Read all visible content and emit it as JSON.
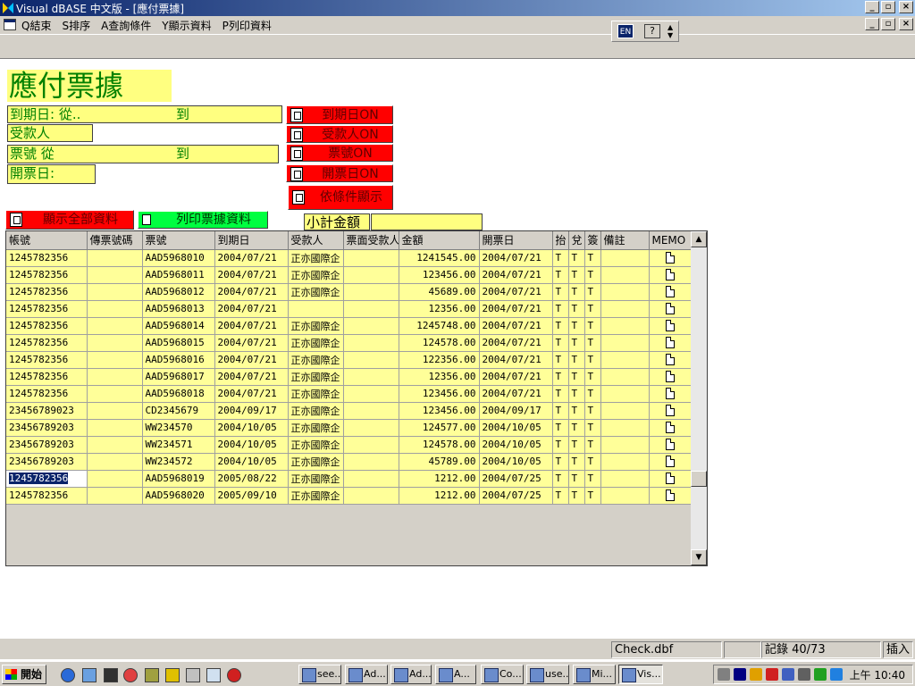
{
  "window": {
    "title": "Visual dBASE 中文版 - [應付票據]"
  },
  "menu": {
    "items": [
      "Q結束",
      "S排序",
      "A查詢條件",
      "Y顯示資料",
      "P列印資料"
    ]
  },
  "ime": {
    "lang": "EN",
    "help": "?"
  },
  "form": {
    "title": "應付票據",
    "due_from_label": "到期日: 從..",
    "due_to_label": "到",
    "payee_label": "受款人",
    "ticket_from_label": "票號 從",
    "ticket_to_label": "到",
    "issue_label": "開票日:",
    "btn_due_on": "到期日ON",
    "btn_payee_on": "受款人ON",
    "btn_ticket_on": "票號ON",
    "btn_issue_on": "開票日ON",
    "btn_filter": "依條件顯示",
    "btn_show_all": "顯示全部資料",
    "btn_print": "列印票據資料",
    "subtotal_label": "小計金額",
    "subtotal_value": ""
  },
  "grid": {
    "columns": [
      "帳號",
      "傳票號碼",
      "票號",
      "到期日",
      "受款人",
      "票面受款人",
      "金額",
      "開票日",
      "抬",
      "兌",
      "簽",
      "備註",
      "MEMO"
    ],
    "rows": [
      [
        "1245782356",
        "",
        "AAD5968010",
        "2004/07/21",
        "正亦國際企",
        "",
        "1241545.00",
        "2004/07/21",
        "T",
        "T",
        "T",
        "",
        ""
      ],
      [
        "1245782356",
        "",
        "AAD5968011",
        "2004/07/21",
        "正亦國際企",
        "",
        "123456.00",
        "2004/07/21",
        "T",
        "T",
        "T",
        "",
        ""
      ],
      [
        "1245782356",
        "",
        "AAD5968012",
        "2004/07/21",
        "正亦國際企",
        "",
        "45689.00",
        "2004/07/21",
        "T",
        "T",
        "T",
        "",
        ""
      ],
      [
        "1245782356",
        "",
        "AAD5968013",
        "2004/07/21",
        "",
        "",
        "12356.00",
        "2004/07/21",
        "T",
        "T",
        "T",
        "",
        ""
      ],
      [
        "1245782356",
        "",
        "AAD5968014",
        "2004/07/21",
        "正亦國際企",
        "",
        "1245748.00",
        "2004/07/21",
        "T",
        "T",
        "T",
        "",
        ""
      ],
      [
        "1245782356",
        "",
        "AAD5968015",
        "2004/07/21",
        "正亦國際企",
        "",
        "124578.00",
        "2004/07/21",
        "T",
        "T",
        "T",
        "",
        ""
      ],
      [
        "1245782356",
        "",
        "AAD5968016",
        "2004/07/21",
        "正亦國際企",
        "",
        "122356.00",
        "2004/07/21",
        "T",
        "T",
        "T",
        "",
        ""
      ],
      [
        "1245782356",
        "",
        "AAD5968017",
        "2004/07/21",
        "正亦國際企",
        "",
        "12356.00",
        "2004/07/21",
        "T",
        "T",
        "T",
        "",
        ""
      ],
      [
        "1245782356",
        "",
        "AAD5968018",
        "2004/07/21",
        "正亦國際企",
        "",
        "123456.00",
        "2004/07/21",
        "T",
        "T",
        "T",
        "",
        ""
      ],
      [
        "23456789023",
        "",
        "CD2345679",
        "2004/09/17",
        "正亦國際企",
        "",
        "123456.00",
        "2004/09/17",
        "T",
        "T",
        "T",
        "",
        ""
      ],
      [
        "23456789203",
        "",
        "WW234570",
        "2004/10/05",
        "正亦國際企",
        "",
        "124577.00",
        "2004/10/05",
        "T",
        "T",
        "T",
        "",
        ""
      ],
      [
        "23456789203",
        "",
        "WW234571",
        "2004/10/05",
        "正亦國際企",
        "",
        "124578.00",
        "2004/10/05",
        "T",
        "T",
        "T",
        "",
        ""
      ],
      [
        "23456789203",
        "",
        "WW234572",
        "2004/10/05",
        "正亦國際企",
        "",
        "45789.00",
        "2004/10/05",
        "T",
        "T",
        "T",
        "",
        ""
      ],
      [
        "1245782356",
        "",
        "AAD5968019",
        "2005/08/22",
        "正亦國際企",
        "",
        "1212.00",
        "2004/07/25",
        "T",
        "T",
        "T",
        "",
        ""
      ],
      [
        "1245782356",
        "",
        "AAD5968020",
        "2005/09/10",
        "正亦國際企",
        "",
        "1212.00",
        "2004/07/25",
        "T",
        "T",
        "T",
        "",
        ""
      ]
    ],
    "selected_row": 13
  },
  "status": {
    "file": "Check.dbf",
    "blank": "",
    "record": "記錄 40/73",
    "mode": "插入"
  },
  "taskbar": {
    "start": "開始",
    "tasks": [
      "see...",
      "Ad...",
      "Ad...",
      "A...",
      "Co...",
      "use...",
      "Mi...",
      "Vis..."
    ],
    "active_task": 7,
    "clock": "上午 10:40"
  },
  "colors": {
    "title_bar": "#0a246a",
    "field_bg": "#ffff80",
    "field_text": "#008000",
    "red_button": "#ff0000",
    "green_button": "#00ff40",
    "grid_row_bg": "#ffff99"
  }
}
